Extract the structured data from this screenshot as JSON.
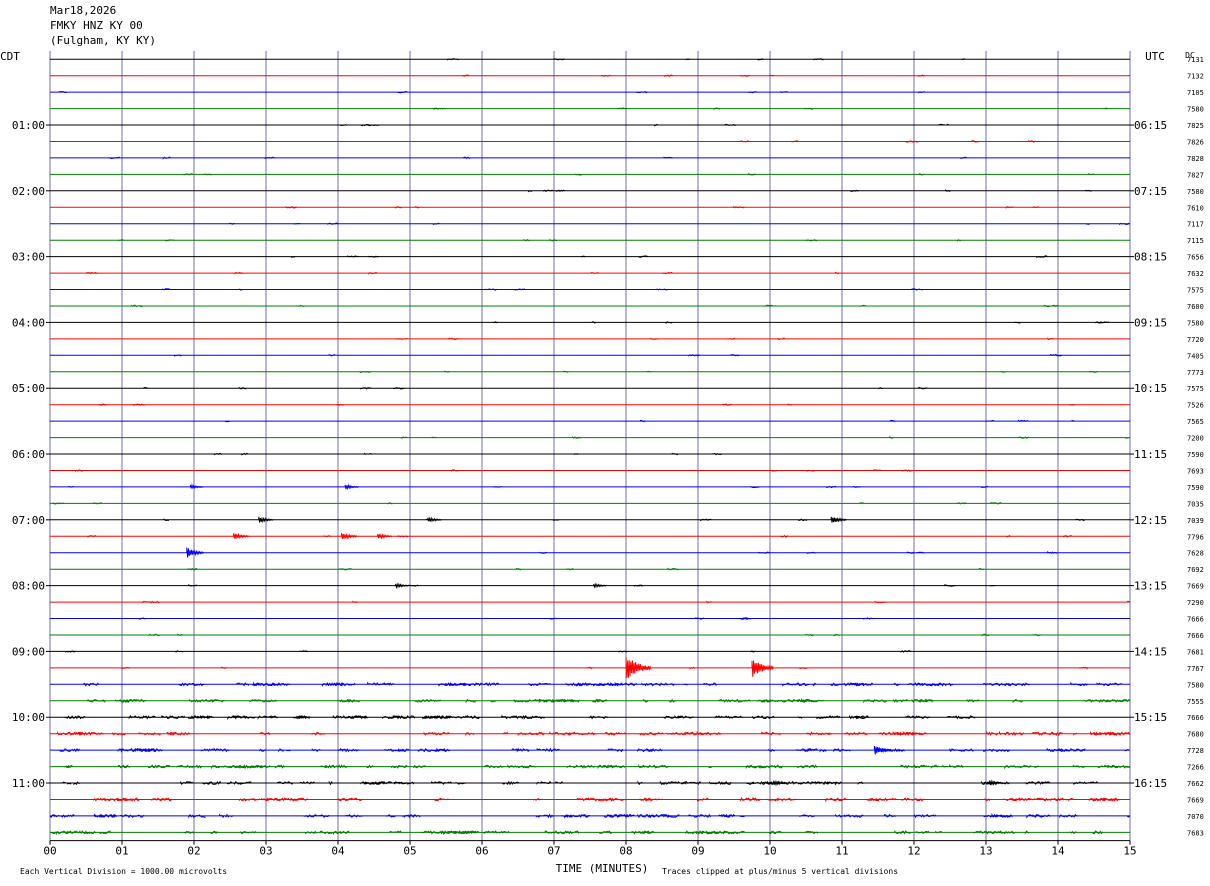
{
  "header": {
    "date": "Mar18,2026",
    "station": "FMKY HNZ KY 00",
    "location": "(Fulgham, KY KY)"
  },
  "axis": {
    "left_label": "CDT",
    "right_label": "UTC",
    "dc_label": "DC",
    "xlabel": "TIME (MINUTES)",
    "footer_left": "Each Vertical Division = 1000.00 microvolts",
    "footer_right": "Traces clipped at plus/minus 5 vertical divisions"
  },
  "colors": {
    "trace_cycle": [
      "#000000",
      "#ff0000",
      "#0000ff",
      "#008000"
    ],
    "grid_vertical": "#7070a0",
    "background": "#ffffff"
  },
  "chart_data": {
    "type": "line",
    "title": "FMKY HNZ KY 00",
    "xlabel": "TIME (MINUTES)",
    "x_ticks": [
      "00",
      "01",
      "02",
      "03",
      "04",
      "05",
      "06",
      "07",
      "08",
      "09",
      "10",
      "11",
      "12",
      "13",
      "14",
      "15"
    ],
    "xlim": [
      0,
      15
    ],
    "trace_count": 48,
    "minutes_per_trace": 15,
    "left_time_labels": [
      {
        "trace": 4,
        "label": "01:00"
      },
      {
        "trace": 8,
        "label": "02:00"
      },
      {
        "trace": 12,
        "label": "03:00"
      },
      {
        "trace": 16,
        "label": "04:00"
      },
      {
        "trace": 20,
        "label": "05:00"
      },
      {
        "trace": 24,
        "label": "06:00"
      },
      {
        "trace": 28,
        "label": "07:00"
      },
      {
        "trace": 32,
        "label": "08:00"
      },
      {
        "trace": 36,
        "label": "09:00"
      },
      {
        "trace": 40,
        "label": "10:00"
      },
      {
        "trace": 44,
        "label": "11:00"
      }
    ],
    "right_time_labels": [
      {
        "trace": 4,
        "label": "06:15"
      },
      {
        "trace": 8,
        "label": "07:15"
      },
      {
        "trace": 12,
        "label": "08:15"
      },
      {
        "trace": 16,
        "label": "09:15"
      },
      {
        "trace": 20,
        "label": "10:15"
      },
      {
        "trace": 24,
        "label": "11:15"
      },
      {
        "trace": 28,
        "label": "12:15"
      },
      {
        "trace": 32,
        "label": "13:15"
      },
      {
        "trace": 36,
        "label": "14:15"
      },
      {
        "trace": 40,
        "label": "15:15"
      },
      {
        "trace": 44,
        "label": "16:15"
      }
    ],
    "dc_offsets": [
      "7131",
      "7132",
      "7105",
      "7580",
      "7825",
      "7826",
      "7828",
      "7827",
      "7580",
      "7610",
      "7117",
      "7115",
      "7656",
      "7632",
      "7575",
      "7600",
      "7580",
      "7720",
      "7405",
      "7773",
      "7575",
      "7526",
      "7565",
      "7200",
      "7590",
      "7693",
      "7590",
      "7035",
      "7039",
      "7796",
      "7628",
      "7692",
      "7669",
      "7290",
      "7666",
      "7666",
      "7681",
      "7767",
      "7580",
      "7555",
      "7666",
      "7680",
      "7728",
      "7266",
      "7662",
      "7669",
      "7070",
      "7683"
    ],
    "events": [
      {
        "trace": 26,
        "minute": 1.95,
        "amp": 1.0
      },
      {
        "trace": 26,
        "minute": 4.1,
        "amp": 1.2
      },
      {
        "trace": 28,
        "minute": 2.9,
        "amp": 1.5
      },
      {
        "trace": 28,
        "minute": 5.25,
        "amp": 1.3
      },
      {
        "trace": 28,
        "minute": 10.85,
        "amp": 1.8
      },
      {
        "trace": 29,
        "minute": 2.55,
        "amp": 1.8
      },
      {
        "trace": 29,
        "minute": 4.05,
        "amp": 2.0
      },
      {
        "trace": 29,
        "minute": 4.55,
        "amp": 1.4
      },
      {
        "trace": 30,
        "minute": 1.9,
        "amp": 2.6
      },
      {
        "trace": 32,
        "minute": 4.8,
        "amp": 1.2
      },
      {
        "trace": 32,
        "minute": 7.55,
        "amp": 1.0
      },
      {
        "trace": 37,
        "minute": 8.0,
        "amp": 6.0
      },
      {
        "trace": 37,
        "minute": 9.75,
        "amp": 4.5
      },
      {
        "trace": 42,
        "minute": 11.45,
        "amp": 2.4
      },
      {
        "trace": 44,
        "minute": 10.05,
        "amp": 1.2
      },
      {
        "trace": 44,
        "minute": 13.05,
        "amp": 1.2
      }
    ],
    "noisy_traces": [
      38,
      39,
      40,
      41,
      42,
      43,
      44,
      45,
      46,
      47
    ],
    "grid": true,
    "legend": "none"
  }
}
